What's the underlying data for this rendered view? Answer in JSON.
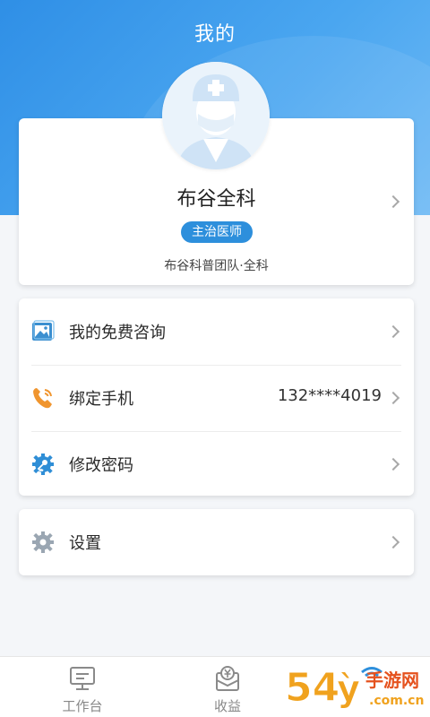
{
  "header": {
    "title": "我的"
  },
  "profile": {
    "name": "布谷全科",
    "badge": "主治医师",
    "team": "布谷科普团队·全科"
  },
  "menu": {
    "consult_label": "我的免费咨询",
    "phone_label": "绑定手机",
    "phone_value": "132****4019",
    "password_label": "修改密码",
    "settings_label": "设置"
  },
  "tabbar": {
    "tabs": [
      {
        "label": "工作台"
      },
      {
        "label": "收益"
      }
    ]
  },
  "watermark": {
    "text": "54 手游网",
    "url_text": ".com.cn"
  },
  "colors": {
    "primary": "#2d8fdc",
    "header_gradient_start": "#2f8fe6",
    "badge": "#2d8fdc"
  }
}
